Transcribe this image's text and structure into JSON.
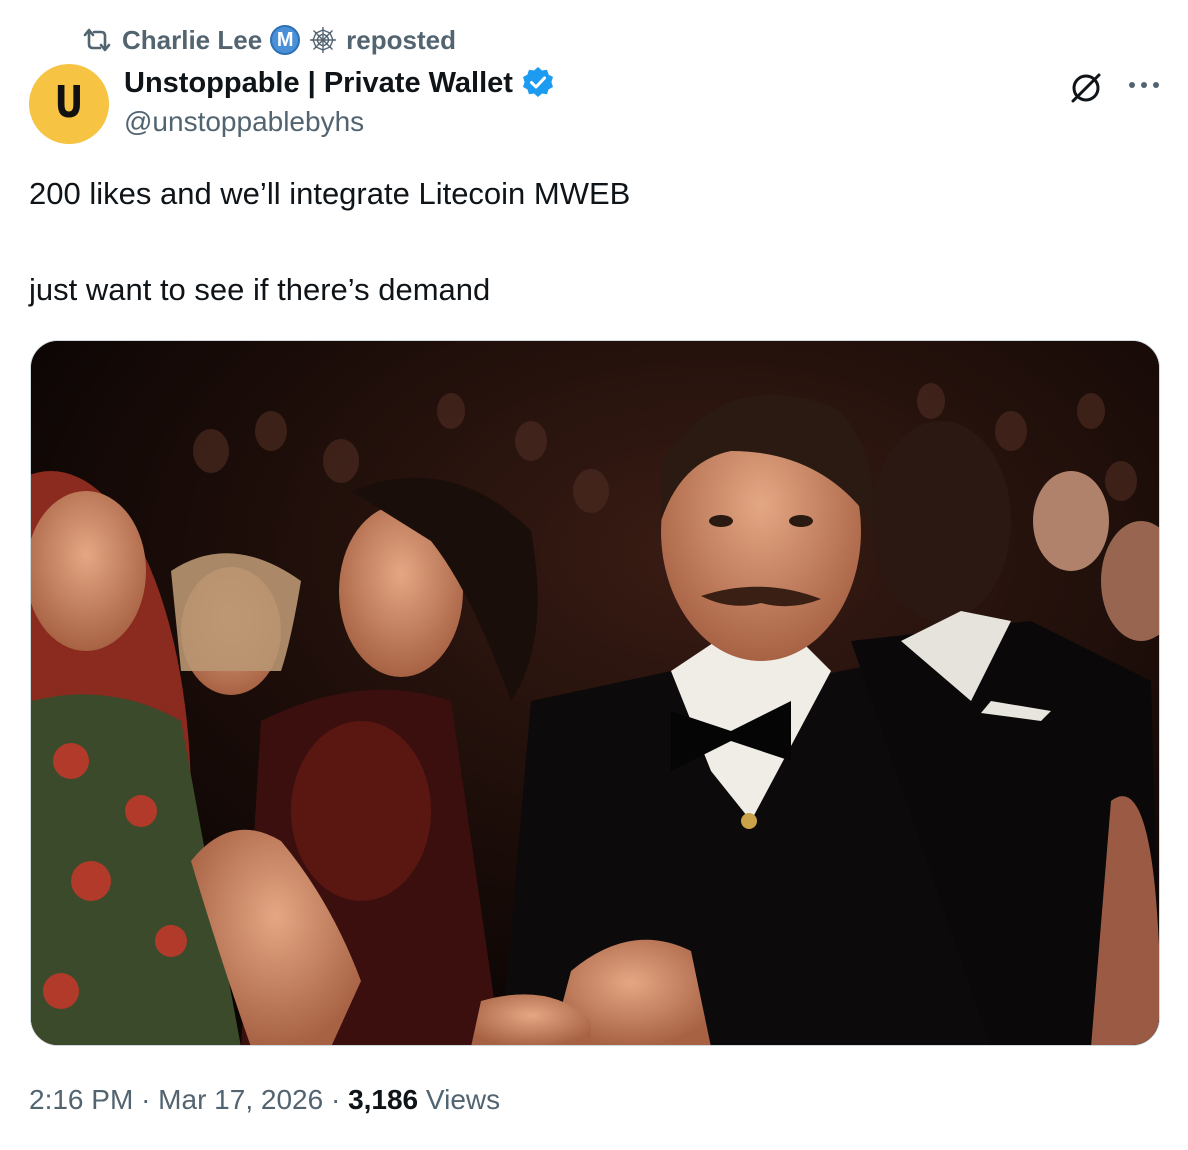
{
  "repost": {
    "user": "Charlie Lee",
    "badge_letter": "M",
    "action": "reposted"
  },
  "author": {
    "avatar_letter": "U",
    "display_name": "Unstoppable | Private Wallet",
    "handle": "@unstoppablebyhs",
    "avatar_color": "#f6c342",
    "verified_color": "#1d9bf0"
  },
  "tweet": {
    "line1": "200 likes and we’ll integrate Litecoin MWEB",
    "line2": "just want to see if there’s demand"
  },
  "footer": {
    "time": "2:16 PM",
    "separator": "·",
    "date": "Mar 17, 2026",
    "views_count": "3,186",
    "views_label": "Views"
  },
  "icons": {
    "repost": "repost-icon",
    "web": "spider-web-icon",
    "verified": "verified-badge-icon",
    "grok": "grok-icon",
    "more": "more-icon"
  }
}
